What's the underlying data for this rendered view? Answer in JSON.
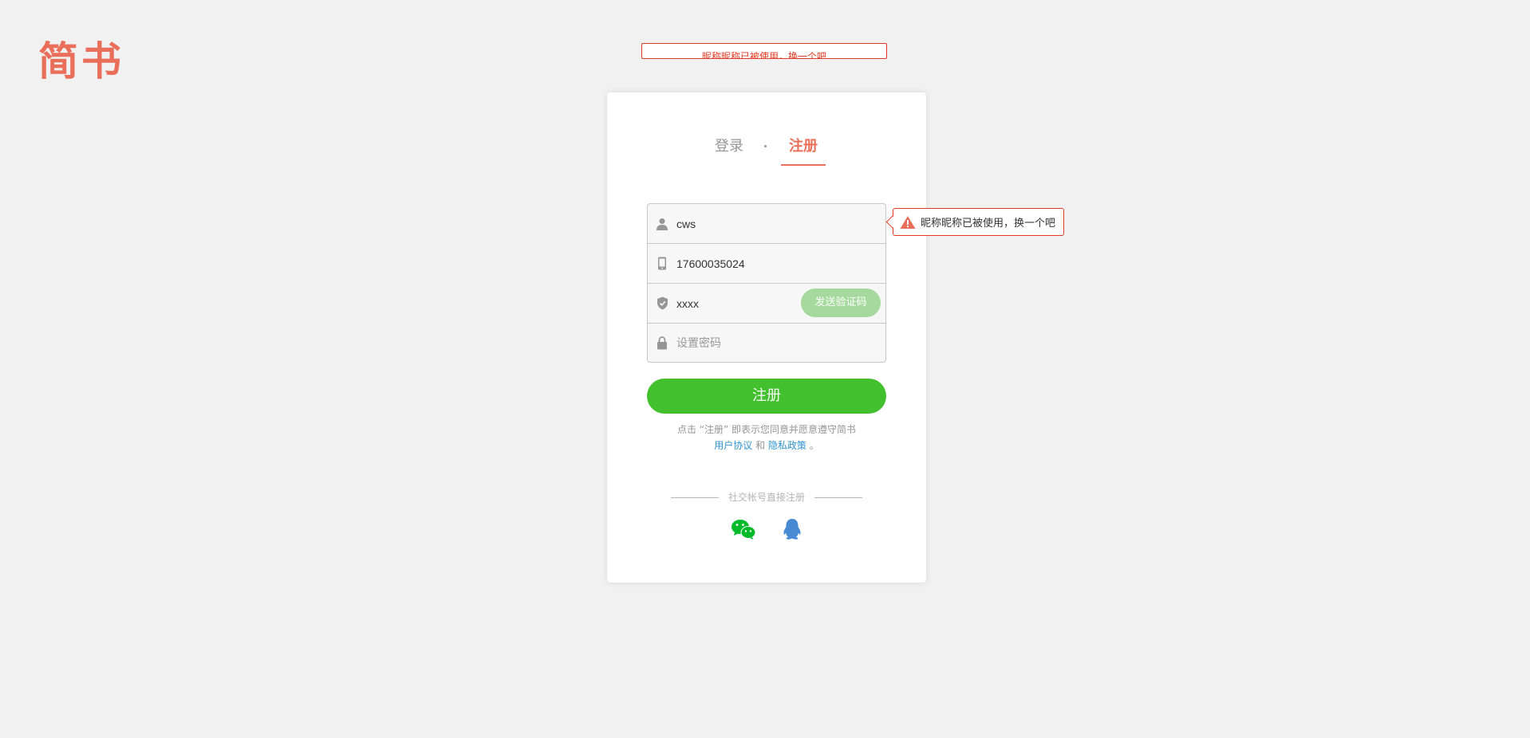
{
  "logo": "简书",
  "top_alert": "昵称昵称已被使用，换一个吧",
  "tabs": {
    "login": "登录",
    "register": "注册"
  },
  "form": {
    "nickname": {
      "value": "cws",
      "icon": "user-icon"
    },
    "phone": {
      "value": "17600035024",
      "icon": "phone-icon"
    },
    "code": {
      "value": "xxxx",
      "icon": "shield-check-icon",
      "send_label": "发送验证码"
    },
    "password": {
      "placeholder": "设置密码",
      "icon": "lock-icon"
    },
    "submit_label": "注册"
  },
  "agreement": {
    "prefix": "点击 “注册” 即表示您同意并愿意遵守简书",
    "user_agreement": "用户协议",
    "and": " 和 ",
    "privacy_policy": "隐私政策",
    "suffix": " 。"
  },
  "social": {
    "title": "社交帐号直接注册",
    "icons": [
      "wechat-icon",
      "qq-icon"
    ]
  },
  "tooltip": {
    "text": "昵称昵称已被使用，换一个吧",
    "icon": "warning-icon"
  },
  "colors": {
    "brand": "#ea6f5a",
    "green": "#42c02e",
    "green_disabled": "#a6d99e",
    "link": "#3194d0",
    "error": "#e33a24",
    "background": "#f1f1f1"
  }
}
